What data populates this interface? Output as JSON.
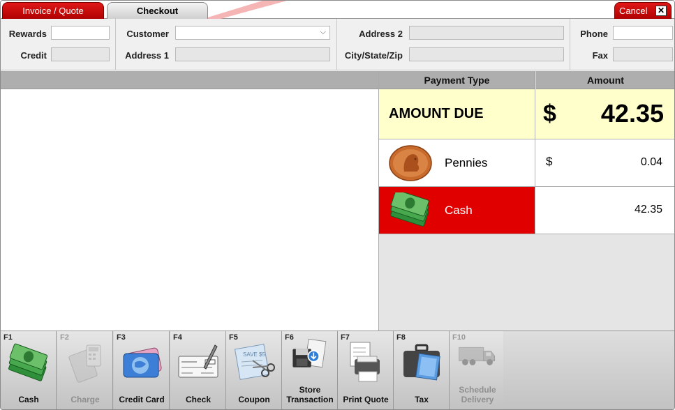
{
  "tabs": {
    "invoice_label": "Invoice / Quote",
    "checkout_label": "Checkout",
    "cancel_label": "Cancel",
    "cancel_x": "✕"
  },
  "info": {
    "rewards_label": "Rewards",
    "credit_label": "Credit",
    "customer_label": "Customer",
    "address1_label": "Address 1",
    "address2_label": "Address 2",
    "city_label": "City/State/Zip",
    "phone_label": "Phone",
    "fax_label": "Fax",
    "rewards_value": "",
    "credit_value": "",
    "customer_value": "",
    "address1_value": "",
    "address2_value": "",
    "city_value": "",
    "phone_value": "",
    "fax_value": ""
  },
  "payments": {
    "col_type": "Payment Type",
    "col_amount": "Amount",
    "amount_due_label": "AMOUNT DUE",
    "amount_due_currency": "$",
    "amount_due_value": "42.35",
    "rows": [
      {
        "label": "Pennies",
        "currency": "$",
        "amount": "0.04",
        "icon": "penny-icon"
      },
      {
        "label": "Cash",
        "currency": "",
        "amount": "42.35",
        "icon": "cash-icon"
      }
    ]
  },
  "function_keys": [
    {
      "key": "F1",
      "label": "Cash",
      "icon": "cash-icon",
      "enabled": true
    },
    {
      "key": "F2",
      "label": "Charge",
      "icon": "charge-icon",
      "enabled": false
    },
    {
      "key": "F3",
      "label": "Credit Card",
      "icon": "credit-card-icon",
      "enabled": true
    },
    {
      "key": "F4",
      "label": "Check",
      "icon": "check-icon",
      "enabled": true
    },
    {
      "key": "F5",
      "label": "Coupon",
      "icon": "coupon-icon",
      "enabled": true
    },
    {
      "key": "F6",
      "label": "Store Transaction",
      "icon": "store-transaction-icon",
      "enabled": true
    },
    {
      "key": "F7",
      "label": "Print Quote",
      "icon": "printer-icon",
      "enabled": true
    },
    {
      "key": "F8",
      "label": "Tax",
      "icon": "briefcase-icon",
      "enabled": true
    },
    {
      "key": "F10",
      "label": "Schedule Delivery",
      "icon": "truck-icon",
      "enabled": false
    }
  ],
  "colors": {
    "accent_red": "#e00000",
    "amount_due_bg": "#ffffcc",
    "header_gray": "#aeaeae"
  }
}
